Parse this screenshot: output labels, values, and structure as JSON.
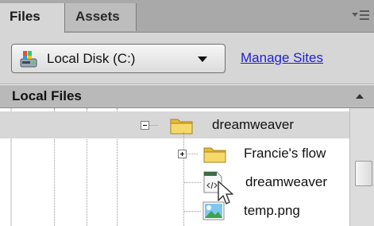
{
  "tabs": [
    {
      "label": "Files",
      "active": true
    },
    {
      "label": "Assets",
      "active": false
    }
  ],
  "toolbar": {
    "disk_label": "Local Disk (C:)",
    "manage_sites_label": "Manage Sites"
  },
  "list_header": {
    "local_files_label": "Local Files"
  },
  "tree": [
    {
      "label": "dreamweaver",
      "icon": "folder-icon",
      "expander": "minus",
      "selected": true
    },
    {
      "label": "Francie's flow",
      "icon": "folder-icon",
      "expander": "plus",
      "selected": false
    },
    {
      "label": "dreamweaver",
      "icon": "html-file-icon",
      "expander": "none",
      "selected": false
    },
    {
      "label": "temp.png",
      "icon": "image-file-icon",
      "expander": "none",
      "selected": false
    }
  ],
  "colors": {
    "link": "#1f1fd6",
    "folder": "#f2c94c",
    "selected_row": "#d7d7d7"
  }
}
